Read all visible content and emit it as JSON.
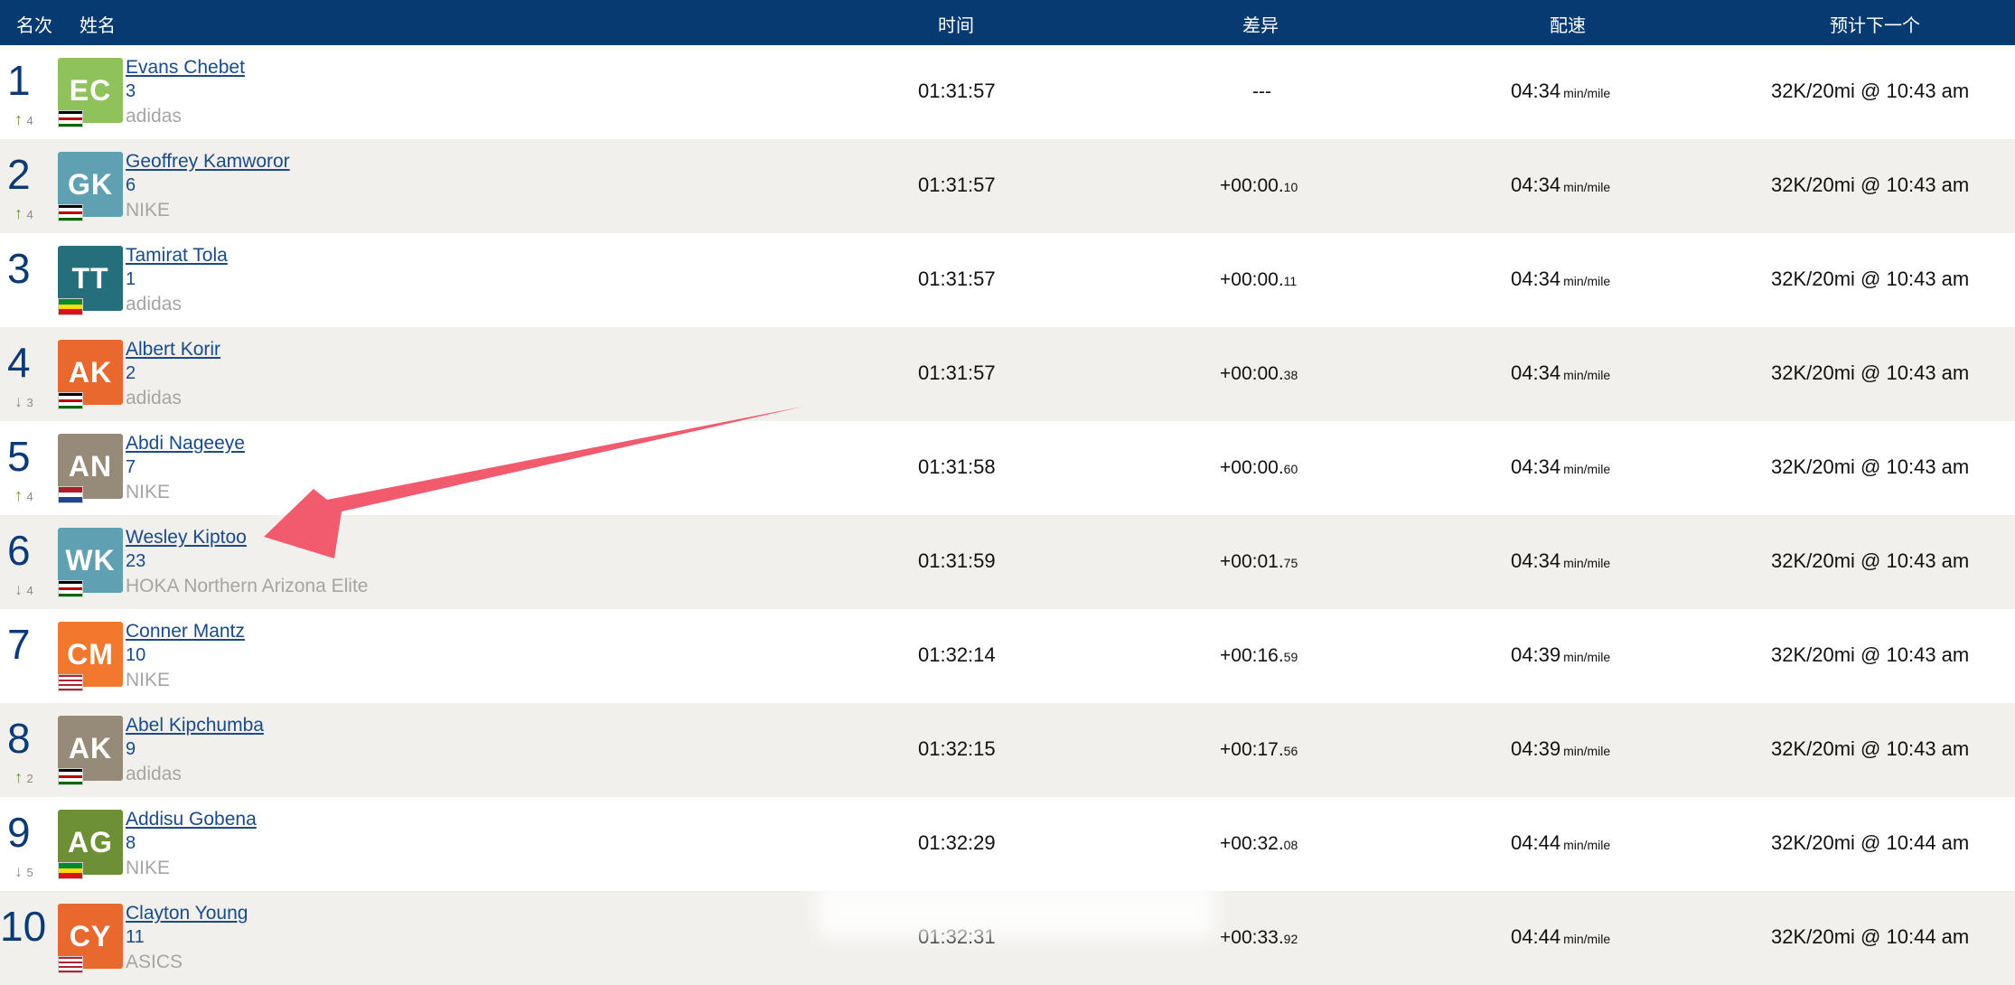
{
  "header": {
    "rank": "名次",
    "name": "姓名",
    "time": "时间",
    "diff": "差异",
    "pace": "配速",
    "projection": "预计下一个"
  },
  "pace_unit": "min/mile",
  "colors": {
    "header_bg": "#063a70",
    "link": "#1a4a8a",
    "alt_row": "#f1f0ec",
    "annotation_arrow": "#f25b6e"
  },
  "rows": [
    {
      "rank": "1",
      "move_dir": "up",
      "move": "4",
      "initials": "EC",
      "avatar_color": "#8fc25a",
      "flag": "kenya-flag",
      "name": "Evans Chebet",
      "bib": "3",
      "team": "adidas",
      "time": "01:31:57",
      "diff_main": "---",
      "diff_small": "",
      "pace": "04:34",
      "projection": "32K/20mi @ 10:43 am"
    },
    {
      "rank": "2",
      "move_dir": "up",
      "move": "4",
      "initials": "GK",
      "avatar_color": "#5fa0b2",
      "flag": "kenya-flag",
      "name": "Geoffrey Kamworor",
      "bib": "6",
      "team": "NIKE",
      "time": "01:31:57",
      "diff_main": "+00:00.",
      "diff_small": "10",
      "pace": "04:34",
      "projection": "32K/20mi @ 10:43 am"
    },
    {
      "rank": "3",
      "move_dir": "",
      "move": "",
      "initials": "TT",
      "avatar_color": "#256f7c",
      "flag": "ethiopia-flag",
      "name": "Tamirat Tola",
      "bib": "1",
      "team": "adidas",
      "time": "01:31:57",
      "diff_main": "+00:00.",
      "diff_small": "11",
      "pace": "04:34",
      "projection": "32K/20mi @ 10:43 am"
    },
    {
      "rank": "4",
      "move_dir": "down",
      "move": "3",
      "initials": "AK",
      "avatar_color": "#e8682e",
      "flag": "kenya-flag",
      "name": "Albert Korir",
      "bib": "2",
      "team": "adidas",
      "time": "01:31:57",
      "diff_main": "+00:00.",
      "diff_small": "38",
      "pace": "04:34",
      "projection": "32K/20mi @ 10:43 am"
    },
    {
      "rank": "5",
      "move_dir": "up",
      "move": "4",
      "initials": "AN",
      "avatar_color": "#968a78",
      "flag": "netherlands-flag",
      "name": "Abdi Nageeye",
      "bib": "7",
      "team": "NIKE",
      "time": "01:31:58",
      "diff_main": "+00:00.",
      "diff_small": "60",
      "pace": "04:34",
      "projection": "32K/20mi @ 10:43 am"
    },
    {
      "rank": "6",
      "move_dir": "down",
      "move": "4",
      "initials": "WK",
      "avatar_color": "#5fa0b2",
      "flag": "kenya-flag",
      "name": "Wesley Kiptoo",
      "bib": "23",
      "team": "HOKA Northern Arizona Elite",
      "time": "01:31:59",
      "diff_main": "+00:01.",
      "diff_small": "75",
      "pace": "04:34",
      "projection": "32K/20mi @ 10:43 am"
    },
    {
      "rank": "7",
      "move_dir": "",
      "move": "",
      "initials": "CM",
      "avatar_color": "#f2782e",
      "flag": "usa-flag",
      "name": "Conner Mantz",
      "bib": "10",
      "team": "NIKE",
      "time": "01:32:14",
      "diff_main": "+00:16.",
      "diff_small": "59",
      "pace": "04:39",
      "projection": "32K/20mi @ 10:43 am"
    },
    {
      "rank": "8",
      "move_dir": "up",
      "move": "2",
      "initials": "AK",
      "avatar_color": "#968a78",
      "flag": "kenya-flag",
      "name": "Abel Kipchumba",
      "bib": "9",
      "team": "adidas",
      "time": "01:32:15",
      "diff_main": "+00:17.",
      "diff_small": "56",
      "pace": "04:39",
      "projection": "32K/20mi @ 10:43 am"
    },
    {
      "rank": "9",
      "move_dir": "down",
      "move": "5",
      "initials": "AG",
      "avatar_color": "#6d8f36",
      "flag": "ethiopia-flag",
      "name": "Addisu Gobena",
      "bib": "8",
      "team": "NIKE",
      "time": "01:32:29",
      "diff_main": "+00:32.",
      "diff_small": "08",
      "pace": "04:44",
      "projection": "32K/20mi @ 10:44 am"
    },
    {
      "rank": "10",
      "move_dir": "",
      "move": "",
      "initials": "CY",
      "avatar_color": "#e8682e",
      "flag": "usa-flag",
      "name": "Clayton Young",
      "bib": "11",
      "team": "ASICS",
      "time": "01:32:31",
      "diff_main": "+00:33.",
      "diff_small": "92",
      "pace": "04:44",
      "projection": "32K/20mi @ 10:44 am"
    }
  ]
}
